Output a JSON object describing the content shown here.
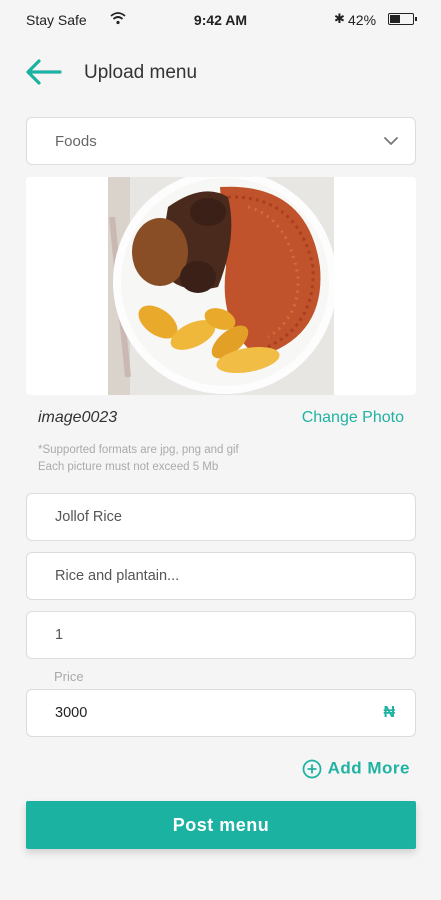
{
  "status_bar": {
    "carrier": "Stay Safe",
    "time": "9:42 AM",
    "battery_percent": "42%",
    "battery_level": 0.42
  },
  "header": {
    "title": "Upload menu",
    "back_icon": "arrow-left-icon"
  },
  "category_select": {
    "value": "Foods",
    "icon": "chevron-down-icon"
  },
  "photo": {
    "file_name": "image0023",
    "change_label": "Change Photo",
    "hint_line1": "*Supported formats are jpg, png and gif",
    "hint_line2": "Each picture must not exceed 5 Mb"
  },
  "form": {
    "name_value": "Jollof Rice",
    "description_value": "Rice and plantain...",
    "quantity_value": "1",
    "price_label": "Price",
    "price_value": "3000",
    "currency_symbol": "₦"
  },
  "actions": {
    "add_more_label": "Add More",
    "post_label": "Post menu"
  },
  "colors": {
    "accent": "#1cb2a2",
    "background": "#f5f5f5"
  }
}
